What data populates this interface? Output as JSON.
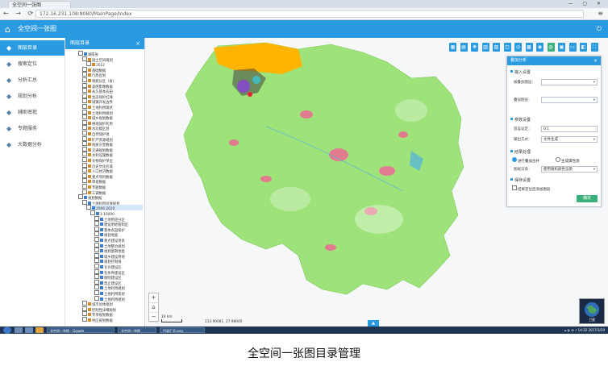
{
  "browser": {
    "tab_title": "全空间一张图",
    "url": "172.16.231.108:8080/MainPage/Index",
    "window_buttons": "— ▢ ✕"
  },
  "app": {
    "title": "全空间一张图",
    "accent_color": "#2a9be0"
  },
  "left_nav": {
    "items": [
      {
        "label": "图层目录",
        "icon": "layers-icon",
        "active": true
      },
      {
        "label": "搜索定位",
        "icon": "search-icon",
        "active": false
      },
      {
        "label": "分析汇总",
        "icon": "analysis-icon",
        "active": false
      },
      {
        "label": "规划分析",
        "icon": "plan-icon",
        "active": false
      },
      {
        "label": "辅助审批",
        "icon": "approval-icon",
        "active": false
      },
      {
        "label": "专题服务",
        "icon": "theme-icon",
        "active": false
      },
      {
        "label": "大数据分析",
        "icon": "bigdata-icon",
        "active": false
      }
    ]
  },
  "catalog": {
    "title": "图层目录",
    "close": "×",
    "nodes": [
      {
        "label": "湖南省",
        "depth": 0,
        "color": "#3d7ec9",
        "hl": false
      },
      {
        "label": "国土空间规划",
        "depth": 1,
        "color": "#d08a2b",
        "hl": false
      },
      {
        "label": "2012",
        "depth": 2,
        "color": "#d08a2b",
        "hl": false
      },
      {
        "label": "基础数据",
        "depth": 1,
        "color": "#d08a2b",
        "hl": false
      },
      {
        "label": "行政区划",
        "depth": 1,
        "color": "#d08a2b",
        "hl": false
      },
      {
        "label": "地貌分区（省）",
        "depth": 1,
        "color": "#d08a2b",
        "hl": false
      },
      {
        "label": "遥感影像数据",
        "depth": 1,
        "color": "#d08a2b",
        "hl": false
      },
      {
        "label": "永久基本农田",
        "depth": 1,
        "color": "#d08a2b",
        "hl": false
      },
      {
        "label": "生态保护红线",
        "depth": 1,
        "color": "#d08a2b",
        "hl": false
      },
      {
        "label": "城镇开发边界",
        "depth": 1,
        "color": "#d08a2b",
        "hl": false
      },
      {
        "label": "土地利用现状",
        "depth": 1,
        "color": "#d08a2b",
        "hl": false
      },
      {
        "label": "土地利用规划",
        "depth": 1,
        "color": "#d08a2b",
        "hl": false
      },
      {
        "label": "城乡规划数据",
        "depth": 1,
        "color": "#d08a2b",
        "hl": false
      },
      {
        "label": "林地保护利用",
        "depth": 1,
        "color": "#d08a2b",
        "hl": false
      },
      {
        "label": "水功能区划",
        "depth": 1,
        "color": "#d08a2b",
        "hl": false
      },
      {
        "label": "自然保护地",
        "depth": 1,
        "color": "#d08a2b",
        "hl": false
      },
      {
        "label": "矿产资源规划",
        "depth": 1,
        "color": "#d08a2b",
        "hl": false
      },
      {
        "label": "地质灾害数据",
        "depth": 1,
        "color": "#d08a2b",
        "hl": false
      },
      {
        "label": "交通规划数据",
        "depth": 1,
        "color": "#d08a2b",
        "hl": false
      },
      {
        "label": "水利设施数据",
        "depth": 1,
        "color": "#d08a2b",
        "hl": false
      },
      {
        "label": "文物保护单位",
        "depth": 1,
        "color": "#d08a2b",
        "hl": false
      },
      {
        "label": "历史文化名城",
        "depth": 1,
        "color": "#d08a2b",
        "hl": false
      },
      {
        "label": "人口经济数据",
        "depth": 1,
        "color": "#d08a2b",
        "hl": false
      },
      {
        "label": "重点项目数据",
        "depth": 1,
        "color": "#d08a2b",
        "hl": false
      },
      {
        "label": "审批数据",
        "depth": 1,
        "color": "#d08a2b",
        "hl": false
      },
      {
        "label": "专题数据",
        "depth": 1,
        "color": "#d08a2b",
        "hl": false
      },
      {
        "label": "三调数据",
        "depth": 1,
        "color": "#d08a2b",
        "hl": false
      },
      {
        "label": "规划数据",
        "depth": 0,
        "color": "#3d7ec9",
        "hl": false
      },
      {
        "label": "土地利用总体规划",
        "depth": 1,
        "color": "#3d7ec9",
        "hl": false
      },
      {
        "label": "2006-2020",
        "depth": 2,
        "color": "#3d7ec9",
        "hl": true
      },
      {
        "label": "1:10000",
        "depth": 3,
        "color": "#3d7ec9",
        "hl": false
      },
      {
        "label": "土地用途分区",
        "depth": 4,
        "color": "#3d7ec9",
        "hl": false
      },
      {
        "label": "建设用地管制区",
        "depth": 4,
        "color": "#3d7ec9",
        "hl": false
      },
      {
        "label": "基本农田保护",
        "depth": 4,
        "color": "#3d7ec9",
        "hl": false
      },
      {
        "label": "规划地类",
        "depth": 4,
        "color": "#3d7ec9",
        "hl": false
      },
      {
        "label": "重点建设项目",
        "depth": 4,
        "color": "#3d7ec9",
        "hl": false
      },
      {
        "label": "土地整治规划",
        "depth": 4,
        "color": "#3d7ec9",
        "hl": false
      },
      {
        "label": "规划基期地类",
        "depth": 4,
        "color": "#3d7ec9",
        "hl": false
      },
      {
        "label": "城乡建设用地",
        "depth": 4,
        "color": "#3d7ec9",
        "hl": false
      },
      {
        "label": "规划控制线",
        "depth": 4,
        "color": "#3d7ec9",
        "hl": false
      },
      {
        "label": "允许建设区",
        "depth": 4,
        "color": "#3d7ec9",
        "hl": false
      },
      {
        "label": "有条件建设区",
        "depth": 4,
        "color": "#3d7ec9",
        "hl": false
      },
      {
        "label": "限制建设区",
        "depth": 4,
        "color": "#3d7ec9",
        "hl": false
      },
      {
        "label": "禁止建设区",
        "depth": 4,
        "color": "#3d7ec9",
        "hl": false
      },
      {
        "label": "土地利用规划",
        "depth": 4,
        "color": "#3d7ec9",
        "hl": false
      },
      {
        "label": "土地利用现状",
        "depth": 4,
        "color": "#3d7ec9",
        "hl": false
      },
      {
        "label": "土地利用规划",
        "depth": 4,
        "color": "#3d7ec9",
        "hl": false
      },
      {
        "label": "城市总体规划",
        "depth": 1,
        "color": "#d08a2b",
        "hl": false
      },
      {
        "label": "控制性详细规划",
        "depth": 1,
        "color": "#d08a2b",
        "hl": false
      },
      {
        "label": "专项规划数据",
        "depth": 1,
        "color": "#d08a2b",
        "hl": false
      },
      {
        "label": "村庄规划数据",
        "depth": 1,
        "color": "#d08a2b",
        "hl": false
      }
    ]
  },
  "map": {
    "scale_label": "10 km",
    "coords": "113.90061, 27.98040",
    "overview_caption": "卫星",
    "zoom_in": "+",
    "zoom_out": "−",
    "zoom_home": "⌂",
    "bottom_tab": "▲",
    "colors": {
      "base": "#9ee37a",
      "urban": "#e07c8e",
      "water": "#5ab7d8",
      "orange": "#ffb400",
      "background": "#f6f7f8"
    }
  },
  "toolbar": {
    "buttons": [
      {
        "icon": "grid-icon",
        "glyph": "▦",
        "color": "#2a9be0"
      },
      {
        "icon": "layers-tool-icon",
        "glyph": "▤",
        "color": "#2a9be0"
      },
      {
        "icon": "pan-icon",
        "glyph": "✥",
        "color": "#2a9be0"
      },
      {
        "icon": "print-icon",
        "glyph": "▥",
        "color": "#2a9be0"
      },
      {
        "icon": "measure-icon",
        "glyph": "▧",
        "color": "#2a9be0"
      },
      {
        "icon": "area-icon",
        "glyph": "◫",
        "color": "#2a9be0"
      },
      {
        "icon": "magnify-icon",
        "glyph": "◎",
        "color": "#2a9be0"
      },
      {
        "icon": "select-icon",
        "glyph": "▩",
        "color": "#2a9be0"
      },
      {
        "icon": "globe-icon",
        "glyph": "◉",
        "color": "#2a9be0"
      },
      {
        "icon": "analysis-tool-icon",
        "glyph": "◍",
        "color": "#3bb07a"
      },
      {
        "icon": "clear-icon",
        "glyph": "▣",
        "color": "#2a9be0"
      },
      {
        "icon": "swipe-icon",
        "glyph": "▭",
        "color": "#2a9be0"
      },
      {
        "icon": "split-icon",
        "glyph": "◧",
        "color": "#2a9be0"
      },
      {
        "icon": "fullscreen-icon",
        "glyph": "⛶",
        "color": "#2a9be0"
      }
    ]
  },
  "settings_panel": {
    "title": "叠加分析",
    "close": "×",
    "section_input": "输入设置",
    "field_analysis_layer": "被叠加图层：",
    "field_overlay_layer": "叠加图层：",
    "section_params": "参数设置",
    "field_tolerance": "容差设定：",
    "tolerance_value": "0.1",
    "field_output_format": "输出方式：",
    "output_format_value": "文件生成",
    "section_result": "结果处理",
    "radio_merge": "进行叠加合并",
    "radio_keep": "生成属性源",
    "field_result_style": "图斑渲染：",
    "result_style_value": "使用随机颜色渲染",
    "section_saving": "保存设置",
    "checkbox_save": "结果定位后添加图层",
    "confirm_button": "确定"
  },
  "taskbar": {
    "apps": [
      {
        "label": "全空间一张图 - Google"
      },
      {
        "label": "全空间一张图"
      },
      {
        "label": "目录汇总.png"
      }
    ],
    "clock": "14:32",
    "date": "2017/3/29"
  },
  "caption": "全空间一张图目录管理"
}
